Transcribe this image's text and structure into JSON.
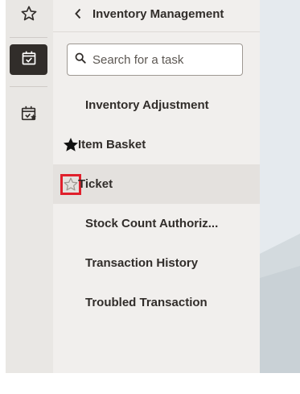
{
  "rail": {
    "items": [
      {
        "icon": "star-outline-icon"
      },
      {
        "icon": "calendar-check-icon",
        "active": true
      },
      {
        "icon": "calendar-star-icon"
      }
    ]
  },
  "panel": {
    "title": "Inventory Management",
    "search": {
      "placeholder": "Search for a task"
    },
    "tasks": [
      {
        "label": "Inventory Adjustment",
        "favorite": null
      },
      {
        "label": "Item Basket",
        "favorite": "filled"
      },
      {
        "label": "Ticket",
        "favorite": "outline",
        "selected": true
      },
      {
        "label": "Stock Count Authoriz...",
        "favorite": null
      },
      {
        "label": "Transaction History",
        "favorite": null
      },
      {
        "label": "Troubled Transaction",
        "favorite": null
      }
    ]
  },
  "colors": {
    "rail_bg": "#e9e7e4",
    "panel_bg": "#f1efed",
    "active_rail": "#312d2a",
    "text": "#312d2a",
    "highlight_border": "#e0202c",
    "content_bg": "#e5eaee"
  }
}
